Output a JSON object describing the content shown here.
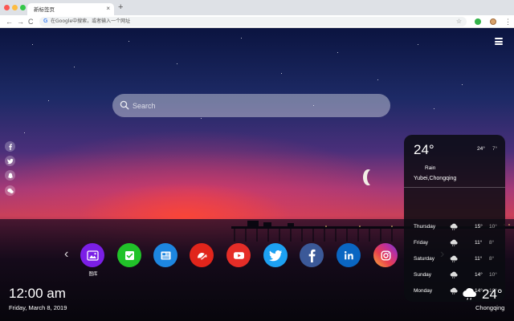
{
  "browser": {
    "tab_title": "新标签页",
    "tab_close": "×",
    "new_tab": "+",
    "omnibox_placeholder": "在Google中搜索，或者输入一个网址",
    "omnibox_badge": "G",
    "nav": {
      "back": "←",
      "forward": "→",
      "reload": "C"
    },
    "star": "☆",
    "menu": "⋮"
  },
  "search": {
    "placeholder": "Search"
  },
  "social_links": [
    {
      "icon": "facebook-icon"
    },
    {
      "icon": "twitter-icon"
    },
    {
      "icon": "snapchat-icon"
    },
    {
      "icon": "wechat-icon"
    }
  ],
  "shortcuts": {
    "prev_arrow": "‹",
    "next_arrow": "›",
    "items": [
      {
        "name": "gallery",
        "label": "图库",
        "color": "#7b1fe6"
      },
      {
        "name": "tasks",
        "color": "#21c229"
      },
      {
        "name": "news",
        "color": "#1d86e0"
      },
      {
        "name": "game",
        "color": "#e1251b"
      },
      {
        "name": "youtube",
        "color": "#e52d27"
      },
      {
        "name": "twitter",
        "color": "#1da1f2"
      },
      {
        "name": "facebook",
        "color": "#3b5998"
      },
      {
        "name": "linkedin",
        "color": "#0a66c2"
      },
      {
        "name": "instagram",
        "color": "#d62f8a"
      }
    ]
  },
  "clock": {
    "time": "12:00 am",
    "date": "Friday, March 8, 2019"
  },
  "weather": {
    "temperature": "24°",
    "high": "24°",
    "low": "7°",
    "condition": "Rain",
    "location": "Yubei,Chongqing",
    "forecast": [
      {
        "day": "Thursday",
        "high": "15°",
        "low": "10°"
      },
      {
        "day": "Friday",
        "high": "11°",
        "low": "8°"
      },
      {
        "day": "Saturday",
        "high": "11°",
        "low": "8°"
      },
      {
        "day": "Sunday",
        "high": "14°",
        "low": "10°"
      },
      {
        "day": "Monday",
        "high": "14°",
        "low": "10°"
      }
    ]
  },
  "weather_mini": {
    "temperature": "24°",
    "city": "Chongqing"
  }
}
